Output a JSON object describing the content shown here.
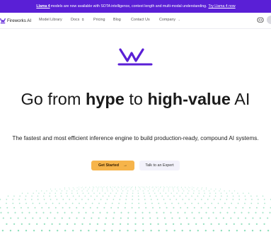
{
  "banner": {
    "link_text": "Llama 4",
    "message": "models are now available with SOTA intelligence, context length and multi-modal understanding.",
    "cta": "Try Llama 4 now"
  },
  "nav": {
    "brand": "Fireworks AI",
    "items": [
      {
        "label": "Model Library"
      },
      {
        "label": "Docs"
      },
      {
        "label": "Pricing"
      },
      {
        "label": "Blog"
      },
      {
        "label": "Contact Us"
      },
      {
        "label": "Company"
      }
    ]
  },
  "hero": {
    "headline_pre": "Go from",
    "headline_b1": "hype",
    "headline_mid": "to",
    "headline_b2": "high-value",
    "headline_post": "AI",
    "subtitle": "The fastest and most efficient inference engine to build production-ready, compound AI systems.",
    "primary_button": "Get Started",
    "primary_arrow": "→",
    "secondary_button": "Talk to an Expert"
  },
  "colors": {
    "brand_purple": "#5a1fd6",
    "cta_orange": "#f6b44a",
    "dot_green": "#7ed9b1"
  }
}
